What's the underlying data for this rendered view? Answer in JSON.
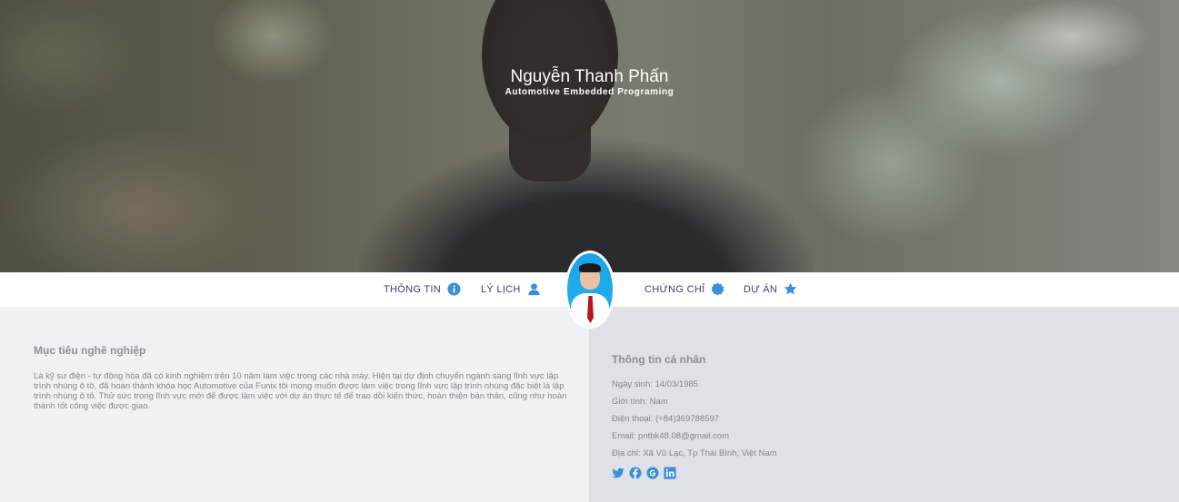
{
  "hero": {
    "name": "Nguyễn Thanh Phấn",
    "subtitle": "Automotive Embedded Programing"
  },
  "nav": {
    "items": [
      {
        "label": "THÔNG TIN",
        "icon": "info-icon"
      },
      {
        "label": "LÝ LỊCH",
        "icon": "user-icon"
      },
      {
        "label": "CHỨNG CHỈ",
        "icon": "certificate-icon"
      },
      {
        "label": "DỰ ÁN",
        "icon": "star-icon"
      }
    ]
  },
  "objective": {
    "title": "Mục tiêu nghề nghiệp",
    "text": "Là kỹ sư điện - tự động hóa đã có kinh nghiệm trên 10 năm làm việc trong các nhà máy. Hiện tại dự định chuyển ngành sang lĩnh vực lập trình nhúng ô tô, đã hoàn thành khóa học Automotive của Funix tôi mong muốn được làm việc trong lĩnh vực lập trình nhúng đặc biệt là lập trình nhúng ô tô. Thử sức trong lĩnh vực mới để được làm việc với dự án thực tế để trao dồi kiến thức, hoàn thiện bản thân, cũng như hoàn thành tốt công việc được giao."
  },
  "personal": {
    "title": "Thông tin cá nhân",
    "rows": [
      "Ngày sinh: 14/03/1985",
      "Giới tính: Nam",
      "Điện thoại: (+84)369788597",
      "Email: pntbk48.08@gmail.com",
      "Địa chỉ: Xã Vũ Lạc, Tp Thái Bình, Việt Nam"
    ],
    "socials": [
      "twitter-icon",
      "facebook-icon",
      "google-icon",
      "linkedin-icon"
    ]
  },
  "colors": {
    "accent": "#3a8fd8",
    "nav_text": "#3b3e7a",
    "muted_text": "#85878d",
    "left_bg": "#f0f1f4",
    "right_bg": "#dfe1e6"
  }
}
